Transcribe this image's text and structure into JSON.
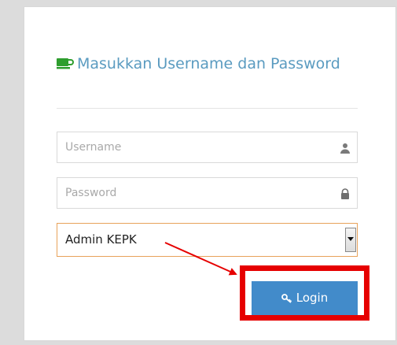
{
  "form": {
    "title": "Masukkan Username dan Password",
    "title_icon": "coffee-cup-icon",
    "username": {
      "placeholder": "Username",
      "value": "",
      "icon": "user-icon"
    },
    "password": {
      "placeholder": "Password",
      "value": "",
      "icon": "lock-icon"
    },
    "role_select": {
      "selected": "Admin KEPK"
    },
    "login": {
      "label": "Login",
      "icon": "key-icon"
    }
  },
  "annotation": {
    "arrow_color": "#e60000",
    "box_color": "#e60000"
  },
  "colors": {
    "accent": "#5a9bc0",
    "button": "#428bca",
    "select_border": "#e8a25a"
  }
}
